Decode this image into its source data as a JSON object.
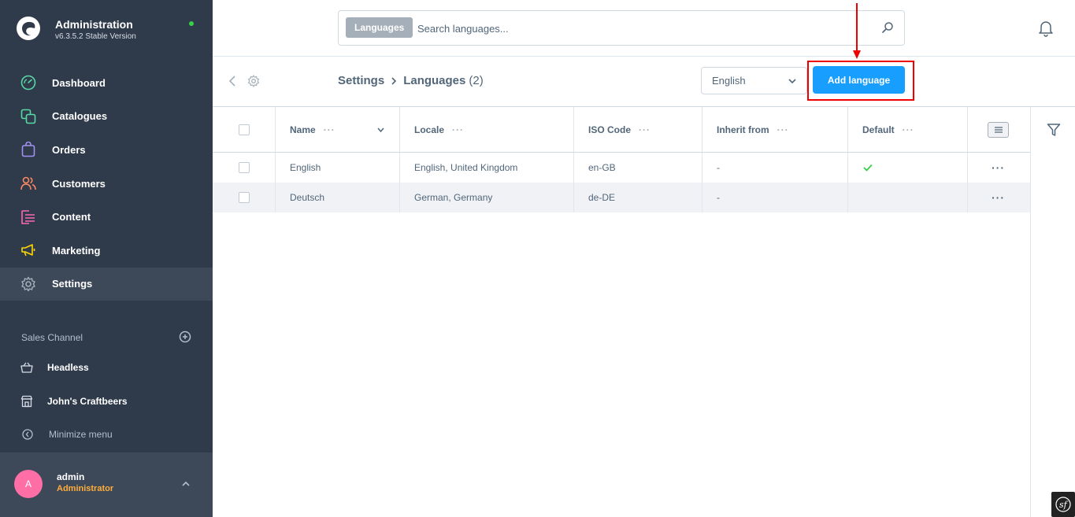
{
  "sidebar": {
    "brand_title": "Administration",
    "brand_version": "v6.3.5.2 Stable Version",
    "items": [
      {
        "label": "Dashboard",
        "icon": "gauge-icon",
        "color": "#57d9a3"
      },
      {
        "label": "Catalogues",
        "icon": "products-icon",
        "color": "#57d9a3"
      },
      {
        "label": "Orders",
        "icon": "shopping-bag-icon",
        "color": "#a092f0"
      },
      {
        "label": "Customers",
        "icon": "users-icon",
        "color": "#f88962"
      },
      {
        "label": "Content",
        "icon": "content-icon",
        "color": "#ff68b4"
      },
      {
        "label": "Marketing",
        "icon": "megaphone-icon",
        "color": "#ffd700"
      },
      {
        "label": "Settings",
        "icon": "cog-icon",
        "color": "#a5afba"
      }
    ],
    "sales_channel_title": "Sales Channel",
    "sales_channels": [
      {
        "label": "Headless",
        "icon": "basket-icon"
      },
      {
        "label": "John's Craftbeers",
        "icon": "storefront-icon"
      }
    ],
    "minimize_label": "Minimize menu",
    "user": {
      "initial": "A",
      "name": "admin",
      "role": "Administrator"
    }
  },
  "topbar": {
    "search_tag": "Languages",
    "search_placeholder": "Search languages..."
  },
  "smartbar": {
    "breadcrumb_parent": "Settings",
    "breadcrumb_current": "Languages",
    "breadcrumb_count": "(2)",
    "language_select": "English",
    "add_button": "Add language"
  },
  "grid": {
    "columns": [
      "Name",
      "Locale",
      "ISO Code",
      "Inherit from",
      "Default"
    ],
    "rows": [
      {
        "name": "English",
        "locale": "English, United Kingdom",
        "iso": "en-GB",
        "inherit": "-",
        "default": true
      },
      {
        "name": "Deutsch",
        "locale": "German, Germany",
        "iso": "de-DE",
        "inherit": "-",
        "default": false
      }
    ]
  },
  "colors": {
    "sidebar_bg": "#2f3a4a",
    "accent": "#189eff",
    "highlight": "#ee0000",
    "check": "#37d046"
  }
}
